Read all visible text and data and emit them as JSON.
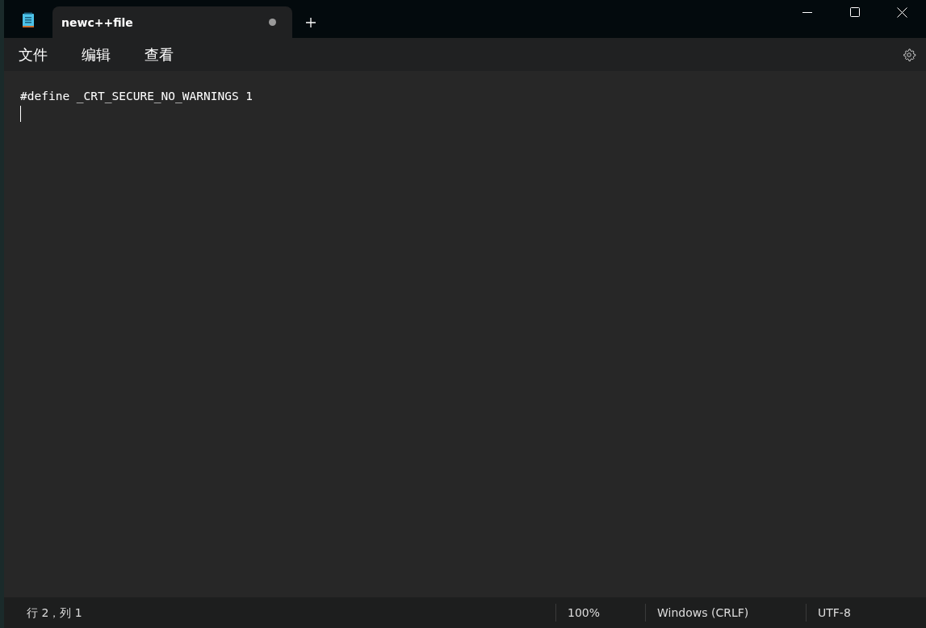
{
  "tabs": [
    {
      "label": "newc++file",
      "selected": true,
      "modified": true
    }
  ],
  "menu": [
    "文件",
    "编辑",
    "查看"
  ],
  "editor": {
    "lines": [
      "#define _CRT_SECURE_NO_WARNINGS 1"
    ]
  },
  "status_bar": {
    "position": "行 2，列 1",
    "zoom": "100%",
    "line_ending": "Windows (CRLF)",
    "encoding": "UTF-8"
  }
}
